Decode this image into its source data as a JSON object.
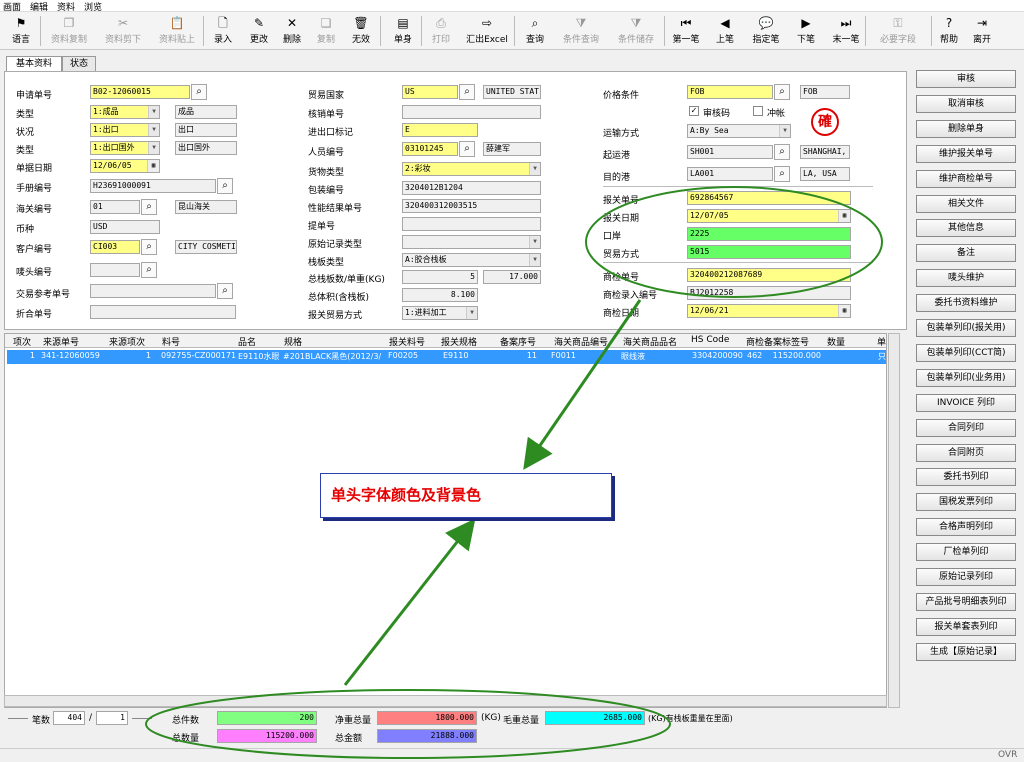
{
  "menu": [
    "画面",
    "编辑",
    "资料",
    "浏览"
  ],
  "toolbar": [
    {
      "icon": "flag-icon",
      "glyph": "⚑",
      "label": "语言",
      "disabled": false
    },
    {
      "icon": "copy-icon",
      "glyph": "❐",
      "label": "资料复制",
      "disabled": true
    },
    {
      "icon": "cut-icon",
      "glyph": "✂",
      "label": "资料剪下",
      "disabled": true
    },
    {
      "icon": "paste-icon",
      "glyph": "📋",
      "label": "资料贴上",
      "disabled": true
    },
    {
      "icon": "new-icon",
      "glyph": "🗋",
      "label": "录入",
      "disabled": false
    },
    {
      "icon": "pencil-icon",
      "glyph": "✎",
      "label": "更改",
      "disabled": false
    },
    {
      "icon": "delete-icon",
      "glyph": "✕",
      "label": "删除",
      "disabled": false
    },
    {
      "icon": "duplicate-icon",
      "glyph": "❏",
      "label": "复制",
      "disabled": true
    },
    {
      "icon": "trash-icon",
      "glyph": "🗑",
      "label": "无效",
      "disabled": false
    },
    {
      "icon": "document-icon",
      "glyph": "▤",
      "label": "单身",
      "disabled": false
    },
    {
      "icon": "printer-icon",
      "glyph": "⎙",
      "label": "打印",
      "disabled": true
    },
    {
      "icon": "export-icon",
      "glyph": "⇨",
      "label": "汇出Excel",
      "disabled": false
    },
    {
      "icon": "binoculars-icon",
      "glyph": "⌕",
      "label": "查询",
      "disabled": false
    },
    {
      "icon": "filter-icon",
      "glyph": "⧩",
      "label": "条件查询",
      "disabled": true
    },
    {
      "icon": "save-filter-icon",
      "glyph": "⧩",
      "label": "条件储存",
      "disabled": true
    },
    {
      "icon": "first-record-icon",
      "glyph": "⏮",
      "label": "第一笔",
      "disabled": false
    },
    {
      "icon": "prev-record-icon",
      "glyph": "◀",
      "label": "上笔",
      "disabled": false
    },
    {
      "icon": "speech-icon",
      "glyph": "💬",
      "label": "指定笔",
      "disabled": false
    },
    {
      "icon": "next-record-icon",
      "glyph": "▶",
      "label": "下笔",
      "disabled": false
    },
    {
      "icon": "last-record-icon",
      "glyph": "⏭",
      "label": "末一笔",
      "disabled": false
    },
    {
      "icon": "key-icon",
      "glyph": "⚿",
      "label": "必要字段",
      "disabled": true
    },
    {
      "icon": "help-icon",
      "glyph": "?",
      "label": "帮助",
      "disabled": false
    },
    {
      "icon": "exit-icon",
      "glyph": "⇥",
      "label": "离开",
      "disabled": false
    }
  ],
  "tabs": [
    "基本资料",
    "状态"
  ],
  "form": {
    "col1": {
      "application_no": {
        "label": "申请单号",
        "value": "B02-12060015"
      },
      "type1": {
        "label": "类型",
        "value": "1:成品",
        "desc": "成品"
      },
      "status": {
        "label": "状况",
        "value": "1:出口",
        "desc": "出口"
      },
      "type2": {
        "label": "类型",
        "value": "1:出口国外",
        "desc": "出口国外"
      },
      "doc_date": {
        "label": "单据日期",
        "value": "12/06/05"
      },
      "handbook_no": {
        "label": "手册编号",
        "value": "H23691000091"
      },
      "customs_no": {
        "label": "海关编号",
        "value": "01",
        "desc": "昆山海关"
      },
      "currency": {
        "label": "币种",
        "value": "USD"
      },
      "customer_no": {
        "label": "客户编号",
        "value": "CI003",
        "desc": "CITY COSMETI"
      },
      "mark_no": {
        "label": "唛头编号",
        "value": ""
      },
      "trade_ref": {
        "label": "交易参考单号",
        "value": ""
      },
      "discount_no": {
        "label": "折合单号",
        "value": ""
      }
    },
    "col2": {
      "trade_country": {
        "label": "贸易国家",
        "value": "US",
        "desc": "UNITED STAT"
      },
      "verify_no": {
        "label": "核销单号",
        "value": ""
      },
      "io_flag": {
        "label": "进出口标记",
        "value": "E"
      },
      "staff_no": {
        "label": "人员编号",
        "value": "03101245",
        "desc": "薛建军"
      },
      "goods_type": {
        "label": "货物类型",
        "value": "2:彩妆"
      },
      "package_no": {
        "label": "包装编号",
        "value": "3204012B1204"
      },
      "perf_result_no": {
        "label": "性能结果单号",
        "value": "320400312003515"
      },
      "bill_no": {
        "label": "提单号",
        "value": ""
      },
      "orig_record_type": {
        "label": "原始记录类型",
        "value": ""
      },
      "pallet_type": {
        "label": "栈板类型",
        "value": "A:胶合栈板"
      },
      "pallet_count": {
        "label": "总栈板数/单重(KG)",
        "value": "5",
        "weight": "17.000"
      },
      "total_volume": {
        "label": "总体积(含栈板)",
        "value": "8.100"
      },
      "declare_trade": {
        "label": "报关贸易方式",
        "value": "1:进料加工"
      }
    },
    "col3": {
      "price_terms": {
        "label": "价格条件",
        "value": "FOB",
        "desc": "FOB"
      },
      "verify_code_label": "审核码",
      "offset_label": "冲帐",
      "transport": {
        "label": "运输方式",
        "value": "A:By Sea"
      },
      "depart_port": {
        "label": "起运港",
        "value": "SH001",
        "desc": "SHANGHAI, C"
      },
      "dest_port": {
        "label": "目的港",
        "value": "LA001",
        "desc": "LA, USA"
      },
      "declare_no": {
        "label": "报关单号",
        "value": "692864567"
      },
      "declare_date": {
        "label": "报关日期",
        "value": "12/07/05"
      },
      "port": {
        "label": "口岸",
        "value": "2225"
      },
      "trade_mode": {
        "label": "贸易方式",
        "value": "5015"
      },
      "inspect_no": {
        "label": "商检单号",
        "value": "320400212087689"
      },
      "inspect_entry_no": {
        "label": "商检录入编号",
        "value": "BJ2012258"
      },
      "inspect_date": {
        "label": "商检日期",
        "value": "12/06/21"
      },
      "stamp_text": "確"
    }
  },
  "grid": {
    "headers": [
      "项次",
      "来源单号",
      "来源项次",
      "料号",
      "品名",
      "规格",
      "报关料号",
      "报关规格",
      "备案序号",
      "海关商品编号",
      "海关商品品名",
      "HS Code",
      "商检备案标签号",
      "数量",
      "单"
    ],
    "row": [
      "1",
      "341-12060059",
      "1",
      "092755-CZ000171",
      "E9110水眼",
      "#201BLACK黑色(2012/3/",
      "F00205",
      "E9110",
      "11",
      "F0011",
      "眼线液",
      "3304200090",
      "462",
      "115200.000",
      "只"
    ]
  },
  "right_buttons": [
    "审核",
    "取消审核",
    "删除单身",
    "维护报关单号",
    "维护商检单号",
    "相关文件",
    "其他信息",
    "备注",
    "唛头维护",
    "委托书资料维护",
    "包装单列印(报关用)",
    "包装单列印(CCT简)",
    "包装单列印(业务用)",
    "INVOICE 列印",
    "合同列印",
    "合同附页",
    "委托书列印",
    "国税发票列印",
    "合格声明列印",
    "厂检单列印",
    "原始记录列印",
    "产品批号明细表列印",
    "报关单套表列印",
    "生成【原始记录】"
  ],
  "bottom": {
    "record_label": "笔数",
    "record_total": "404",
    "record_sep": "/",
    "record_current": "1",
    "total_pieces_label": "总件数",
    "total_pieces": "200",
    "net_weight_label": "净重总量",
    "net_weight": "1800.000",
    "net_unit": "(KG)",
    "gross_weight_label": "毛重总量",
    "gross_weight": "2685.000",
    "gross_note": "(KG)有栈板重量在里面)",
    "total_qty_label": "总数量",
    "total_qty": "115200.000",
    "total_amount_label": "总金额",
    "total_amount": "21888.000"
  },
  "callout_text": "单头字体颜色及背景色",
  "status_mode": "OVR",
  "colors": {
    "yellow": "#ffff88",
    "green": "#66ff66",
    "pieces": "#80ff80",
    "net": "#ff8080",
    "gross": "#00ffff",
    "qty": "#ff80ff",
    "amount": "#8080ff",
    "annotation": "#2e8b22",
    "selected": "#3399ff"
  }
}
